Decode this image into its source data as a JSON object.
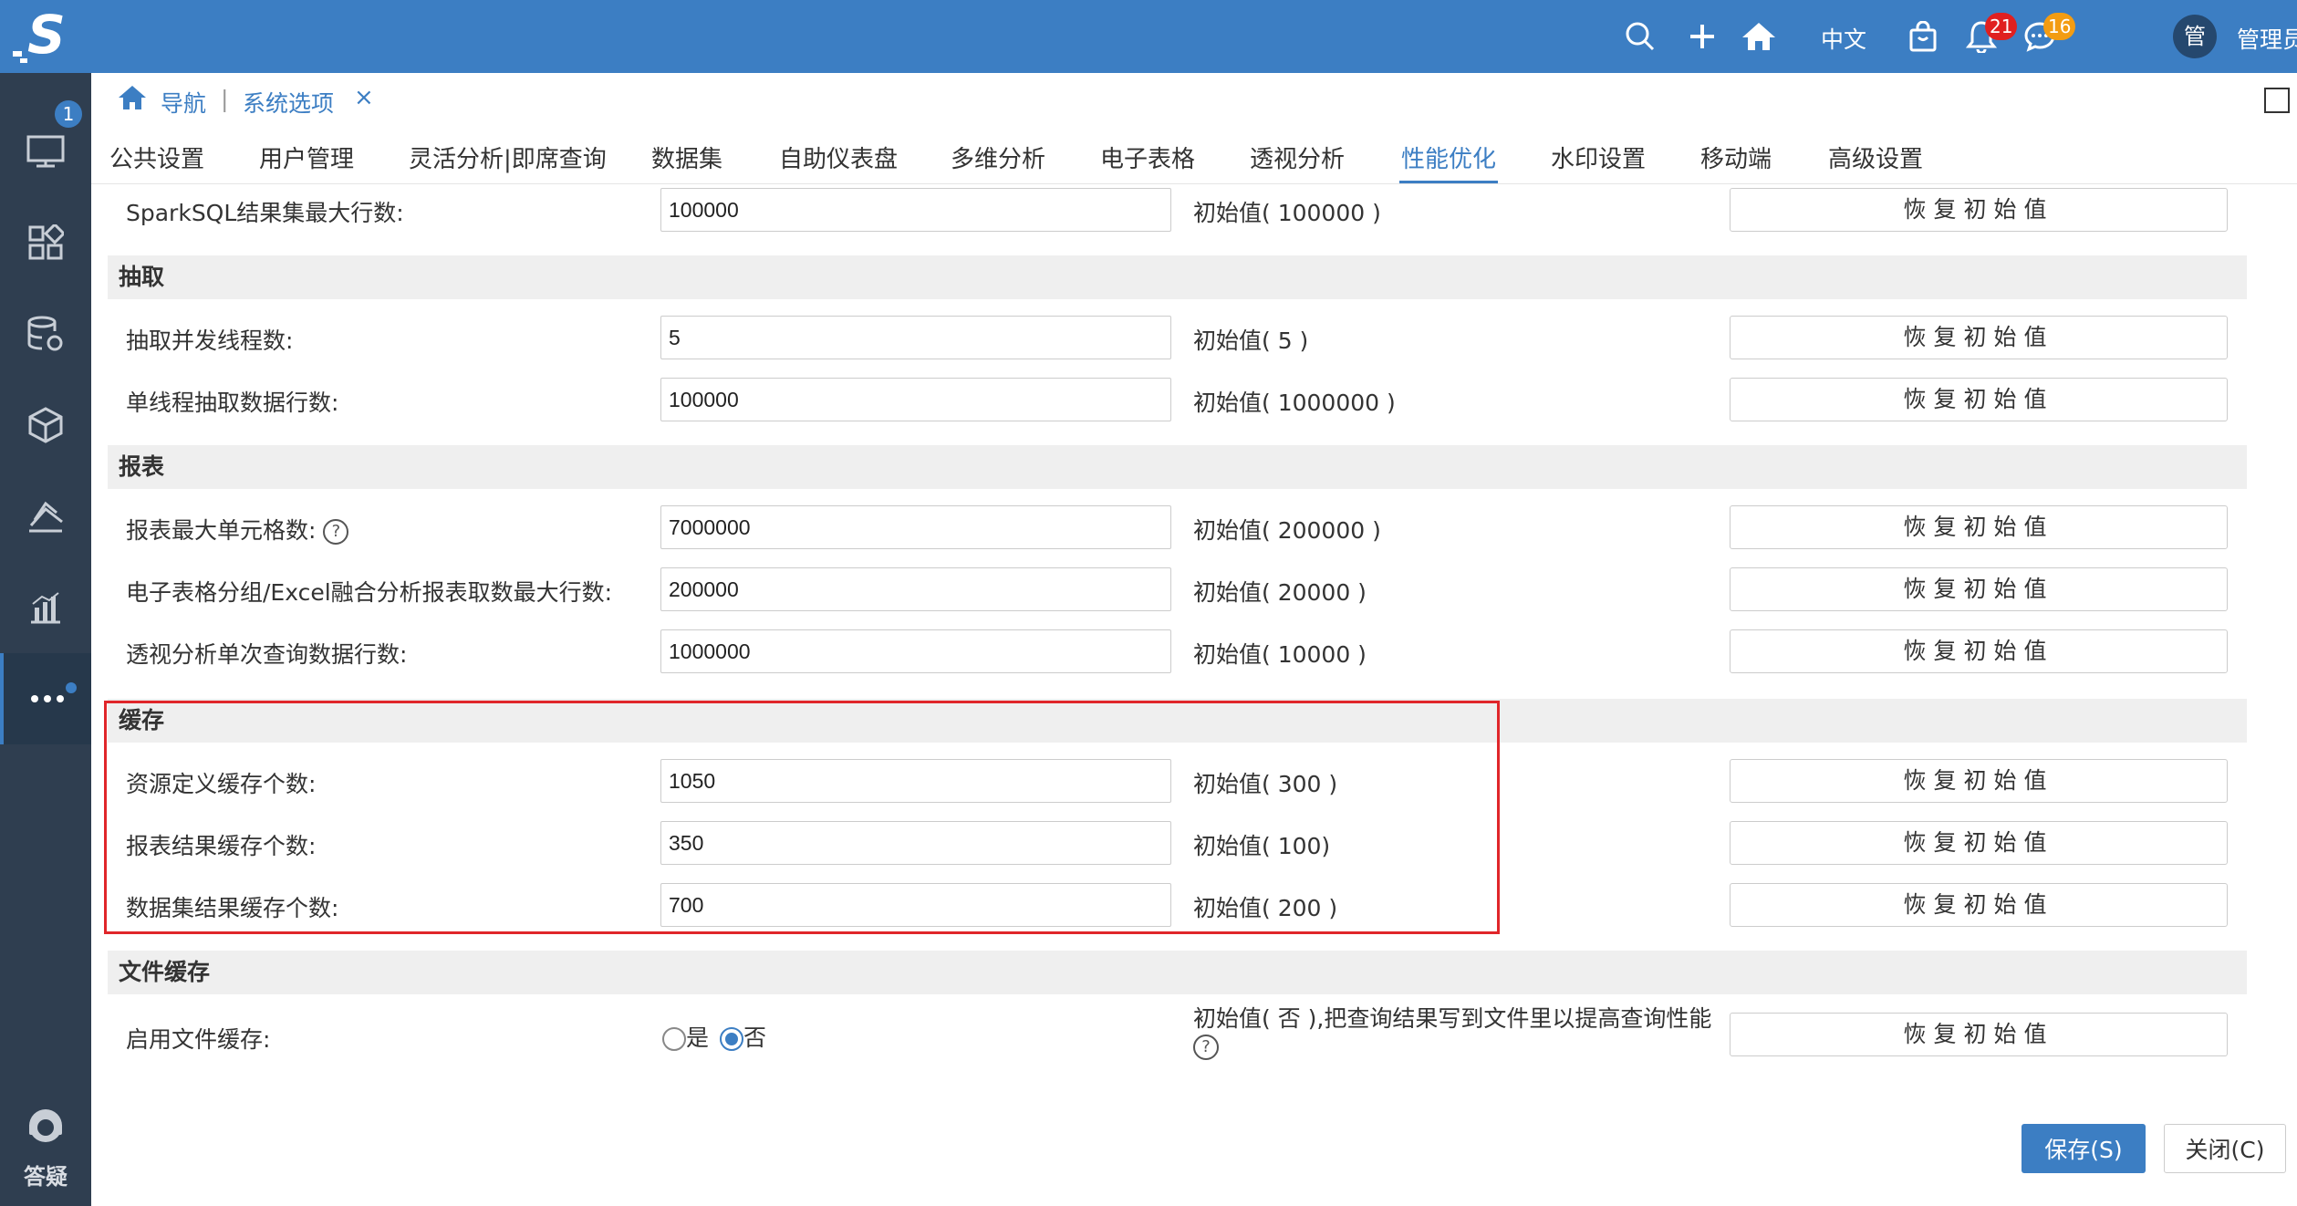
{
  "app": {
    "brand_letter": "S"
  },
  "colors": {
    "primary": "#3c7ec3",
    "sidebar": "#2f3e50",
    "highlight": "#e0262a",
    "bell_badge": "#e02020",
    "chat_badge": "#f39c12"
  },
  "sidebar": {
    "items": [
      {
        "icon": "monitor-icon",
        "badge": "1"
      },
      {
        "icon": "grid-icon"
      },
      {
        "icon": "database-gear-icon"
      },
      {
        "icon": "cube-icon"
      },
      {
        "icon": "layers-icon"
      },
      {
        "icon": "bar-chart-icon"
      },
      {
        "icon": "more-icon"
      }
    ],
    "help_label": "答疑"
  },
  "topbar": {
    "language": "中文",
    "notifications_count": "21",
    "messages_count": "16",
    "avatar_char": "管",
    "username": "管理员"
  },
  "breadcrumb": {
    "home": "导航",
    "separator": "|",
    "current": "系统选项",
    "close": "×"
  },
  "tabs": [
    "公共设置",
    "用户管理",
    "灵活分析|即席查询",
    "数据集",
    "自助仪表盘",
    "多维分析",
    "电子表格",
    "透视分析",
    "性能优化",
    "水印设置",
    "移动端",
    "高级设置"
  ],
  "active_tab": "性能优化",
  "restore_label": "恢复初始值",
  "top_row": {
    "label": "SparkSQL结果集最大行数:",
    "value": "100000",
    "init": "初始值( 100000 )"
  },
  "sections": {
    "extract": {
      "title": "抽取",
      "rows": [
        {
          "label": "抽取并发线程数:",
          "value": "5",
          "init": "初始值( 5 )"
        },
        {
          "label": "单线程抽取数据行数:",
          "value": "100000",
          "init": "初始值( 1000000 )"
        }
      ]
    },
    "report": {
      "title": "报表",
      "rows": [
        {
          "label": "报表最大单元格数:",
          "value": "7000000",
          "init": "初始值( 200000 )"
        },
        {
          "label": "电子表格分组/Excel融合分析报表取数最大行数:",
          "value": "200000",
          "init": "初始值( 20000 )"
        },
        {
          "label": "透视分析单次查询数据行数:",
          "value": "1000000",
          "init": "初始值( 10000 )"
        }
      ]
    },
    "cache": {
      "title": "缓存",
      "rows": [
        {
          "label": "资源定义缓存个数:",
          "value": "1050",
          "init": "初始值( 300 )"
        },
        {
          "label": "报表结果缓存个数:",
          "value": "350",
          "init": "初始值( 100)"
        },
        {
          "label": "数据集结果缓存个数:",
          "value": "700",
          "init": "初始值( 200 )"
        }
      ]
    },
    "file_cache": {
      "title": "文件缓存",
      "row": {
        "label": "启用文件缓存:",
        "option_yes": "是",
        "option_no": "否",
        "selected": "否",
        "init": "初始值( 否 ),把查询结果写到文件里以提高查询性能"
      }
    }
  },
  "footer": {
    "save": "保存(S)",
    "close": "关闭(C)"
  }
}
